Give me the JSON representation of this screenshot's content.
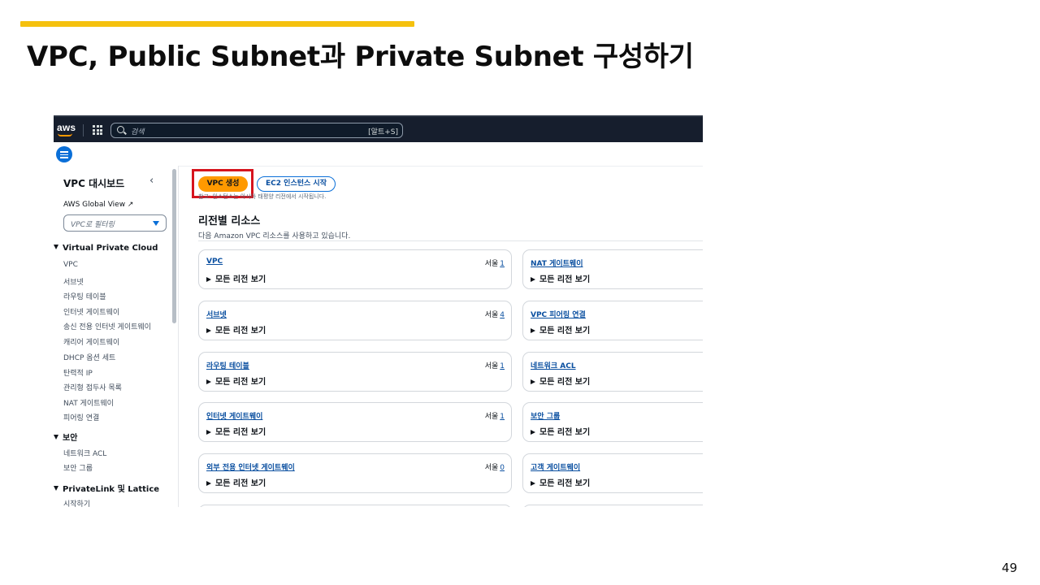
{
  "slide": {
    "title": "VPC, Public Subnet과 Private Subnet 구성하기",
    "page_number": "49"
  },
  "colors": {
    "accent_bar": "#f5c10e",
    "aws_orange": "#ff9900",
    "highlight": "#d6141e",
    "link": "#0a4fa0"
  },
  "topnav": {
    "logo": "aws",
    "search_placeholder": "검색",
    "search_shortcut": "[알트+S]",
    "icons": [
      "aws-logo",
      "services-grid-icon",
      "search-icon"
    ]
  },
  "sidebar": {
    "title": "VPC 대시보드",
    "collapse_icon": "chevron-left-icon",
    "global_view": "AWS Global View ↗",
    "filter_placeholder": "VPC로 필터링",
    "sections": [
      {
        "label": "Virtual Private Cloud",
        "items": [
          "VPC",
          "서브넷",
          "라우팅 테이블",
          "인터넷 게이트웨이",
          "송신 전용 인터넷 게이트웨이",
          "캐리어 게이트웨이",
          "DHCP 옵션 세트",
          "탄력적 IP",
          "관리형 접두사 목록",
          "NAT 게이트웨이",
          "피어링 연결"
        ]
      },
      {
        "label": "보안",
        "items": [
          "네트워크 ACL",
          "보안 그룹"
        ]
      },
      {
        "label": "PrivateLink 및 Lattice",
        "items": [
          "시작하기"
        ]
      }
    ]
  },
  "main": {
    "create_vpc_button": "VPC 생성",
    "launch_ec2_button": "EC2 인스턴스 시작",
    "note": "참고: 인스턴스는 아시아 태평양 리전에서 시작됩니다.",
    "resources_title": "리전별 리소스",
    "resources_subtitle": "다음 Amazon VPC 리소스를 사용하고 있습니다.",
    "show_all_label": "모든 리전 보기",
    "left_cards": [
      {
        "name": "VPC",
        "region": "서울",
        "count": "1"
      },
      {
        "name": "서브넷",
        "region": "서울",
        "count": "4"
      },
      {
        "name": "라우팅 테이블",
        "region": "서울",
        "count": "1"
      },
      {
        "name": "인터넷 게이트웨이",
        "region": "서울",
        "count": "1"
      },
      {
        "name": "외부 전용 인터넷 게이트웨이",
        "region": "서울",
        "count": "0"
      }
    ],
    "right_cards": [
      {
        "name": "NAT 게이트웨이"
      },
      {
        "name": "VPC 피어링 연결"
      },
      {
        "name": "네트워크 ACL"
      },
      {
        "name": "보안 그룹"
      },
      {
        "name": "고객 게이트웨이"
      }
    ]
  }
}
